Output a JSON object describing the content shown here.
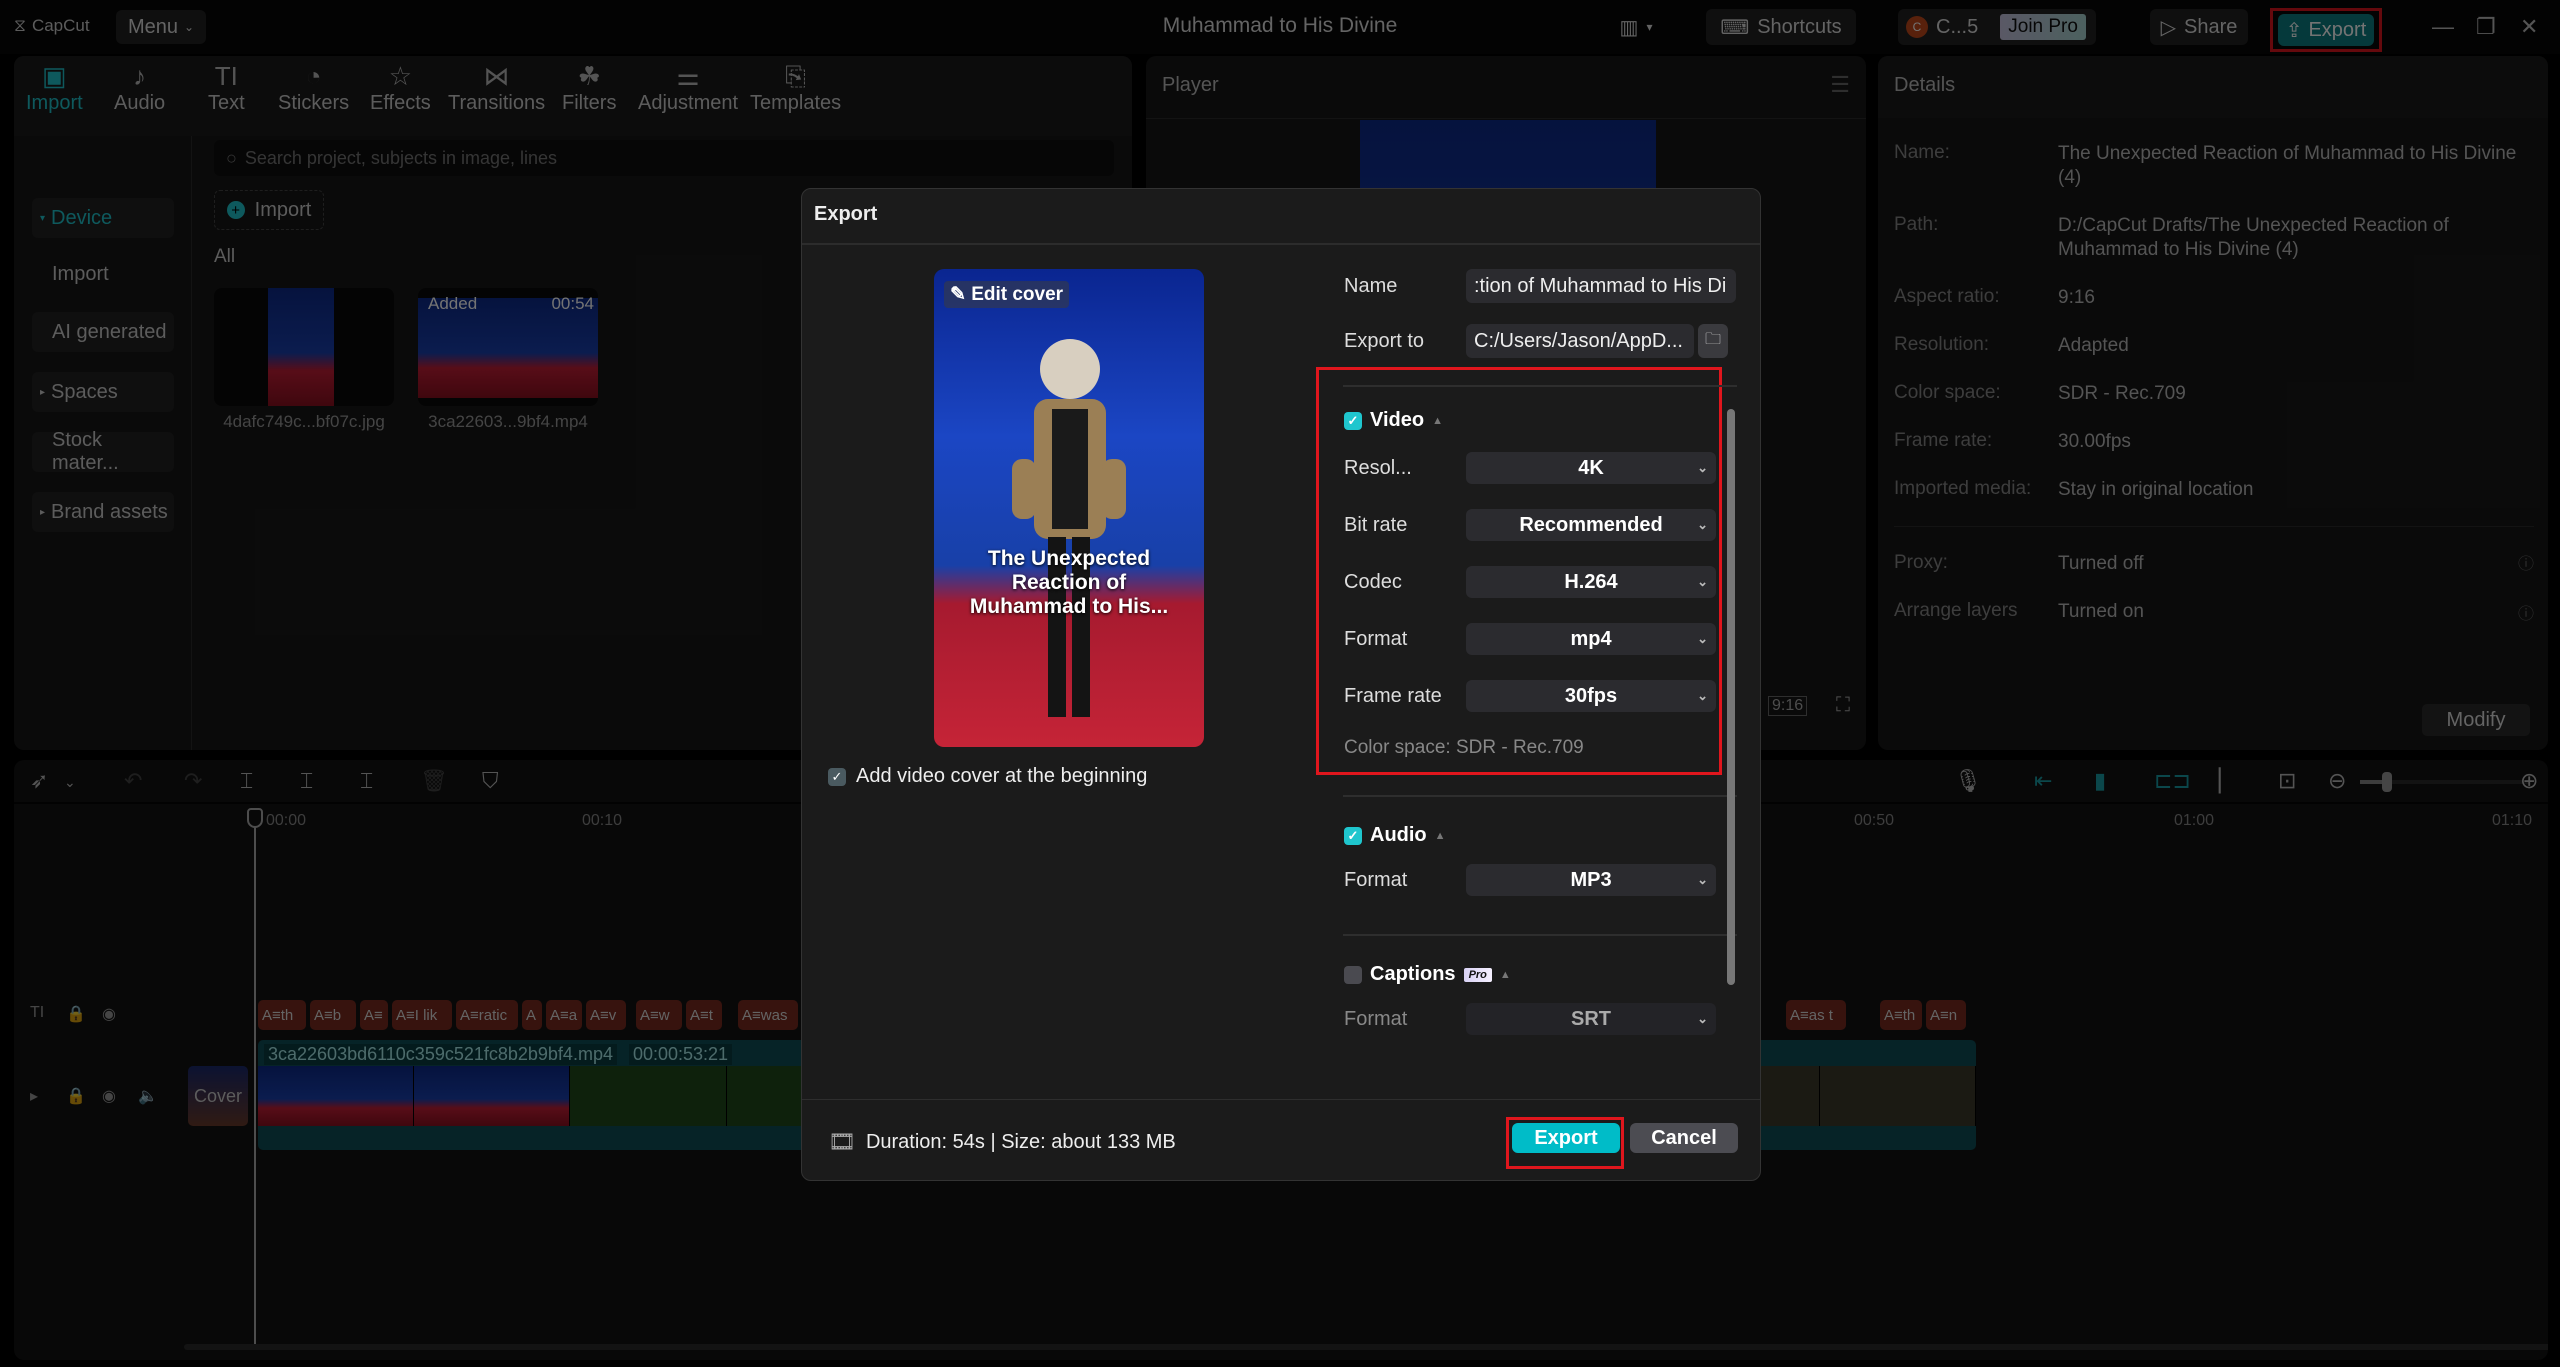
{
  "titlebar": {
    "logo": "CapCut",
    "menu_label": "Menu",
    "project_title": "Muhammad to His Divine",
    "shortcuts_label": "Shortcuts",
    "user_initial": "C",
    "user_name": "C...5",
    "join_pro_label": "Join Pro",
    "share_label": "Share",
    "export_label": "Export"
  },
  "media": {
    "tabs": [
      {
        "label": "Import",
        "icon": "import-icon",
        "active": true
      },
      {
        "label": "Audio",
        "icon": "audio-icon"
      },
      {
        "label": "Text",
        "icon": "text-icon"
      },
      {
        "label": "Stickers",
        "icon": "stickers-icon"
      },
      {
        "label": "Effects",
        "icon": "effects-icon"
      },
      {
        "label": "Transitions",
        "icon": "transitions-icon"
      },
      {
        "label": "Filters",
        "icon": "filters-icon"
      },
      {
        "label": "Adjustment",
        "icon": "adjustment-icon"
      },
      {
        "label": "Templates",
        "icon": "templates-icon"
      }
    ],
    "sidebar": [
      {
        "label": "Device",
        "active": true,
        "expandable": true
      },
      {
        "label": "Import"
      },
      {
        "label": "AI generated"
      },
      {
        "label": "Spaces",
        "expandable": true
      },
      {
        "label": "Stock mater..."
      },
      {
        "label": "Brand assets",
        "expandable": true
      }
    ],
    "search_placeholder": "Search project, subjects in image, lines",
    "import_label": "Import",
    "all_label": "All",
    "items": [
      {
        "name": "4dafc749c...bf07c.jpg"
      },
      {
        "name": "3ca22603...9bf4.mp4",
        "badge": "Added",
        "duration": "00:54"
      }
    ]
  },
  "player": {
    "title": "Player",
    "aspect": "9:16"
  },
  "details": {
    "title": "Details",
    "rows": [
      {
        "label": "Name:",
        "value": "The Unexpected Reaction of Muhammad to His Divine (4)"
      },
      {
        "label": "Path:",
        "value": "D:/CapCut Drafts/The Unexpected Reaction of Muhammad to His Divine (4)"
      },
      {
        "label": "Aspect ratio:",
        "value": "9:16"
      },
      {
        "label": "Resolution:",
        "value": "Adapted"
      },
      {
        "label": "Color space:",
        "value": "SDR - Rec.709"
      },
      {
        "label": "Frame rate:",
        "value": "30.00fps"
      },
      {
        "label": "Imported media:",
        "value": "Stay in original location"
      },
      {
        "label": "Proxy:",
        "value": "Turned off"
      },
      {
        "label": "Arrange layers",
        "value": "Turned on"
      }
    ],
    "modify_label": "Modify"
  },
  "timeline": {
    "ruler": [
      "00:00",
      "00:10",
      "00:50",
      "01:00",
      "01:10"
    ],
    "caption_clips": [
      "th",
      "b",
      "",
      "I lik",
      "ratic",
      "",
      "a",
      "v",
      "w",
      "t",
      "was",
      "as t",
      "th",
      "n"
    ],
    "main_clip_name": "3ca22603bd6110c359c521fc8b2b9bf4.mp4",
    "main_clip_duration": "00:00:53:21",
    "cover_label": "Cover"
  },
  "export_dialog": {
    "title": "Export",
    "edit_cover_label": "Edit cover",
    "cover_caption": "The Unexpected Reaction of Muhammad to His...",
    "add_cover_label": "Add video cover at the beginning",
    "add_cover_checked": true,
    "name_label": "Name",
    "name_value": ":tion of Muhammad to His Di",
    "export_to_label": "Export to",
    "export_to_value": "C:/Users/Jason/AppD...",
    "video": {
      "label": "Video",
      "checked": true,
      "resolution_label": "Resol...",
      "resolution": "4K",
      "bitrate_label": "Bit rate",
      "bitrate": "Recommended",
      "codec_label": "Codec",
      "codec": "H.264",
      "format_label": "Format",
      "format": "mp4",
      "framerate_label": "Frame rate",
      "framerate": "30fps",
      "color_space": "Color space: SDR - Rec.709"
    },
    "audio": {
      "label": "Audio",
      "checked": true,
      "format_label": "Format",
      "format": "MP3"
    },
    "captions": {
      "label": "Captions",
      "checked": false,
      "pro_badge": "Pro",
      "format_label": "Format",
      "format": "SRT"
    },
    "footer_info": "Duration: 54s | Size: about 133 MB",
    "export_button": "Export",
    "cancel_button": "Cancel"
  },
  "colors": {
    "accent": "#00bcc8",
    "highlight": "#e0161d"
  }
}
